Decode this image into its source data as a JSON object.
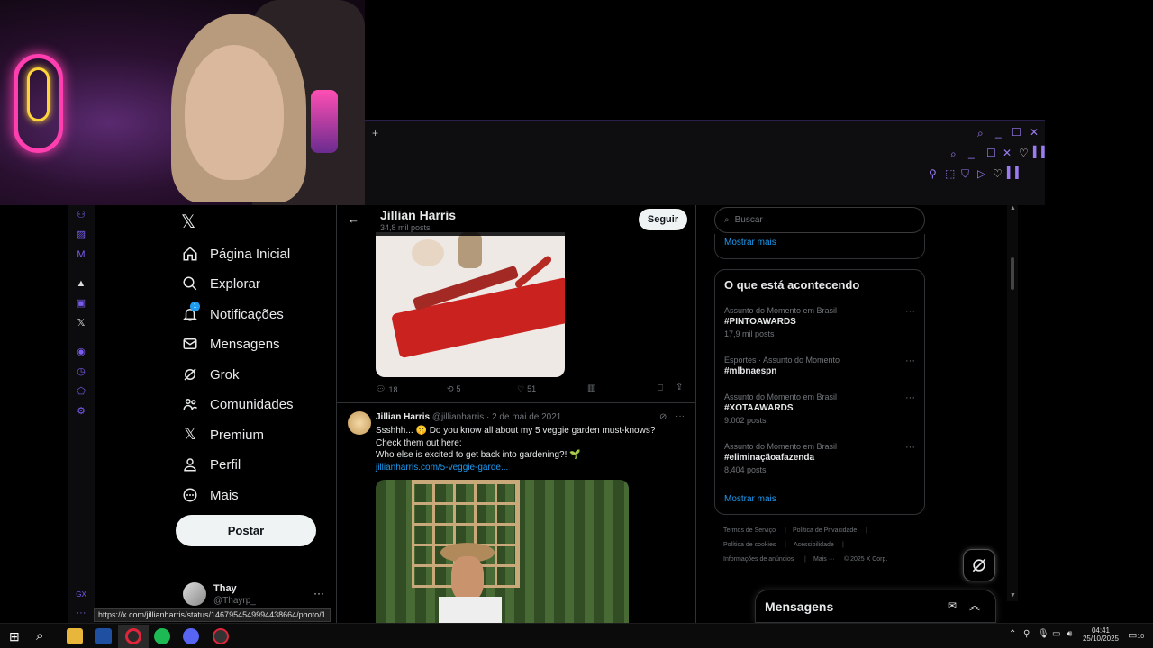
{
  "browser": {
    "status_url": "https://x.com/jillianharris/status/1467954549994438664/photo/1"
  },
  "x_nav": {
    "items": [
      {
        "label": "Página Inicial",
        "icon": "home-icon"
      },
      {
        "label": "Explorar",
        "icon": "search-icon"
      },
      {
        "label": "Notificações",
        "icon": "bell-icon",
        "badge": "1"
      },
      {
        "label": "Mensagens",
        "icon": "mail-icon"
      },
      {
        "label": "Grok",
        "icon": "grok-icon"
      },
      {
        "label": "Comunidades",
        "icon": "people-icon"
      },
      {
        "label": "Premium",
        "icon": "x-logo-icon"
      },
      {
        "label": "Perfil",
        "icon": "person-icon"
      },
      {
        "label": "Mais",
        "icon": "more-circle-icon"
      }
    ],
    "post_label": "Postar",
    "account": {
      "name": "Thay",
      "handle": "@Thayrp_"
    }
  },
  "profile_header": {
    "name": "Jillian Harris",
    "posts_count": "34,8 mil posts",
    "follow_label": "Seguir"
  },
  "tweet1": {
    "replies": "18",
    "retweets": "5",
    "likes": "51"
  },
  "tweet2": {
    "name": "Jillian Harris",
    "handle_date": "@jillianharris · 2 de mai de 2021",
    "line1": "Ssshhh... 🤫 Do you know all about my 5 veggie garden must-knows?",
    "line2": "Check them out here:",
    "line3": "Who else is excited to get back into gardening?! 🌱",
    "link": "jillianharris.com/5-veggie-garde..."
  },
  "right": {
    "search_placeholder": "Buscar",
    "show_more_top": "Mostrar mais",
    "trends_title": "O que está acontecendo",
    "trends": [
      {
        "context": "Assunto do Momento em Brasil",
        "title": "#PINTOAWARDS",
        "count": "17,9 mil posts"
      },
      {
        "context": "Esportes · Assunto do Momento",
        "title": "#mlbnaespn",
        "count": ""
      },
      {
        "context": "Assunto do Momento em Brasil",
        "title": "#XOTAAWARDS",
        "count": "9.002 posts"
      },
      {
        "context": "Assunto do Momento em Brasil",
        "title": "#eliminaçãoafazenda",
        "count": "8.404 posts"
      }
    ],
    "show_more": "Mostrar mais",
    "footer": {
      "terms": "Termos de Serviço",
      "privacy": "Política de Privacidade",
      "cookies": "Política de cookies",
      "accessibility": "Acessibilidade",
      "ads": "Informações de anúncios",
      "more": "Mais ···",
      "copyright": "© 2025 X Corp."
    },
    "messages_title": "Mensagens"
  },
  "taskbar": {
    "time": "04:41",
    "date": "25/10/2025",
    "notif_count": "10"
  }
}
